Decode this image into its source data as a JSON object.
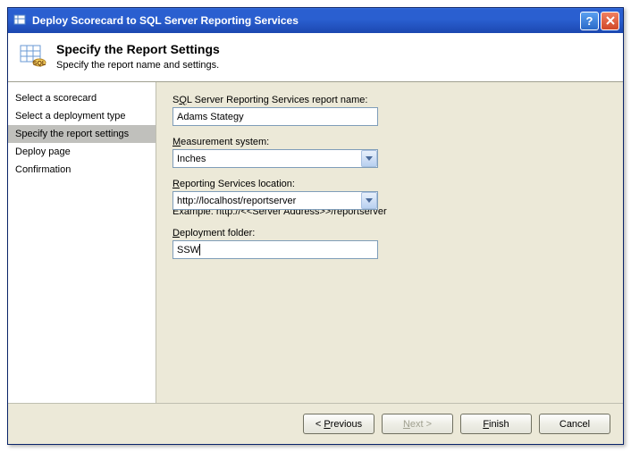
{
  "window": {
    "title": "Deploy Scorecard to SQL Server Reporting Services"
  },
  "header": {
    "title": "Specify the Report Settings",
    "subtitle": "Specify the report name and settings."
  },
  "sidebar": {
    "items": [
      {
        "label": "Select a scorecard",
        "selected": false
      },
      {
        "label": "Select a deployment type",
        "selected": false
      },
      {
        "label": "Specify the report settings",
        "selected": true
      },
      {
        "label": "Deploy page",
        "selected": false
      },
      {
        "label": "Confirmation",
        "selected": false
      }
    ]
  },
  "form": {
    "report_name_label_pre": "S",
    "report_name_label_u": "Q",
    "report_name_label_post": "L Server Reporting Services report name:",
    "report_name_value": "Adams Stategy",
    "measurement_label_u": "M",
    "measurement_label_post": "easurement system:",
    "measurement_value": "Inches",
    "location_label_u": "R",
    "location_label_post": "eporting Services location:",
    "location_value": "http://localhost/reportserver",
    "location_example": "Example: http://<<Server Address>>/reportserver",
    "folder_label_u": "D",
    "folder_label_post": "eployment folder:",
    "folder_value": "SSW"
  },
  "footer": {
    "previous_pre": "< ",
    "previous_u": "P",
    "previous_post": "revious",
    "next_u": "N",
    "next_post": "ext >",
    "finish_u": "F",
    "finish_post": "inish",
    "cancel": "Cancel"
  }
}
